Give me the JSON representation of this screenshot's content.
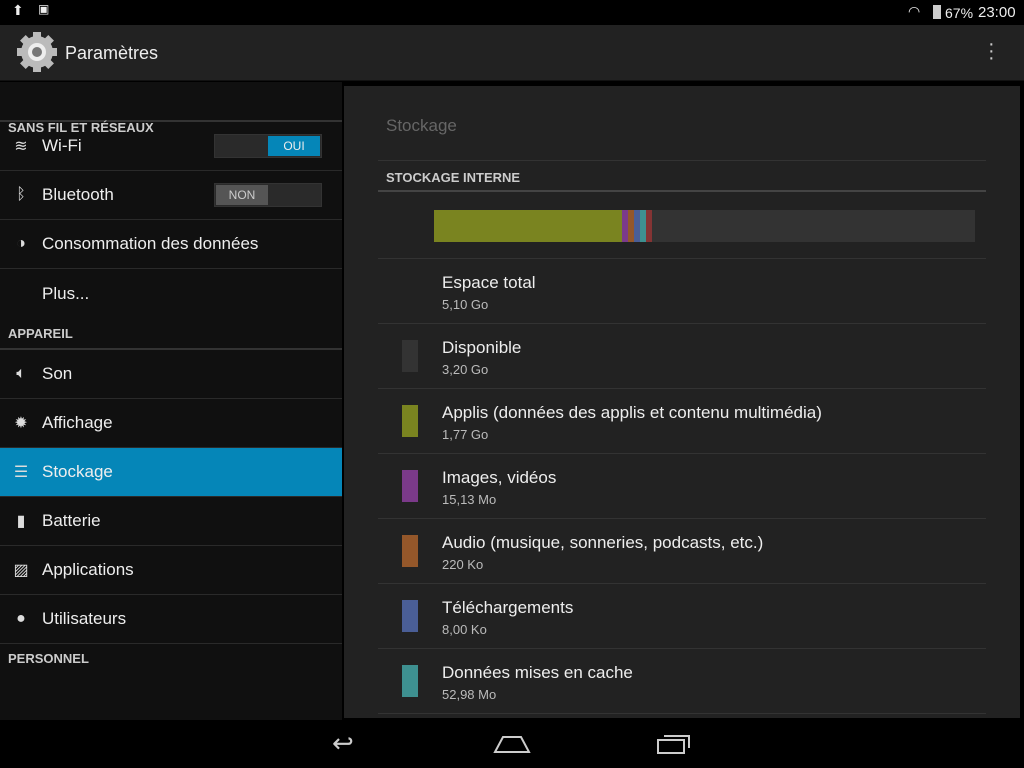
{
  "status": {
    "battery": "67%",
    "time": "23:00"
  },
  "app": {
    "title": "Paramètres"
  },
  "sidebar": {
    "sections": [
      "SANS FIL ET RÉSEAUX",
      "APPAREIL",
      "PERSONNEL"
    ],
    "wifi": {
      "label": "Wi-Fi",
      "toggle": "OUI"
    },
    "bluetooth": {
      "label": "Bluetooth",
      "toggle": "NON"
    },
    "items": [
      {
        "label": "Consommation des données"
      },
      {
        "label": "Plus..."
      },
      {
        "label": "Son"
      },
      {
        "label": "Affichage"
      },
      {
        "label": "Stockage",
        "selected": true
      },
      {
        "label": "Batterie"
      },
      {
        "label": "Applications"
      },
      {
        "label": "Utilisateurs"
      }
    ]
  },
  "main": {
    "title": "Stockage",
    "section": "STOCKAGE INTERNE",
    "rows": [
      {
        "title": "Espace total",
        "value": "5,10 Go",
        "color": ""
      },
      {
        "title": "Disponible",
        "value": "3,20 Go",
        "color": "#333333"
      },
      {
        "title": "Applis (données des applis et contenu multimédia)",
        "value": "1,77 Go",
        "color": "#7a8420"
      },
      {
        "title": "Images, vidéos",
        "value": "15,13 Mo",
        "color": "#7b3a8a"
      },
      {
        "title": "Audio (musique, sonneries, podcasts, etc.)",
        "value": "220 Ko",
        "color": "#94572a"
      },
      {
        "title": "Téléchargements",
        "value": "8,00 Ko",
        "color": "#4a5e96"
      },
      {
        "title": "Données mises en cache",
        "value": "52,98 Mo",
        "color": "#3e9090"
      }
    ],
    "bar": [
      {
        "color": "#7a8420",
        "pct": 34.8
      },
      {
        "color": "#7b3a8a",
        "pct": 1.1
      },
      {
        "color": "#94572a",
        "pct": 1.1
      },
      {
        "color": "#4a5e96",
        "pct": 1.1
      },
      {
        "color": "#3e9090",
        "pct": 1.1
      },
      {
        "color": "#843434",
        "pct": 1.1
      },
      {
        "color": "#333333",
        "pct": 59.7
      }
    ]
  }
}
